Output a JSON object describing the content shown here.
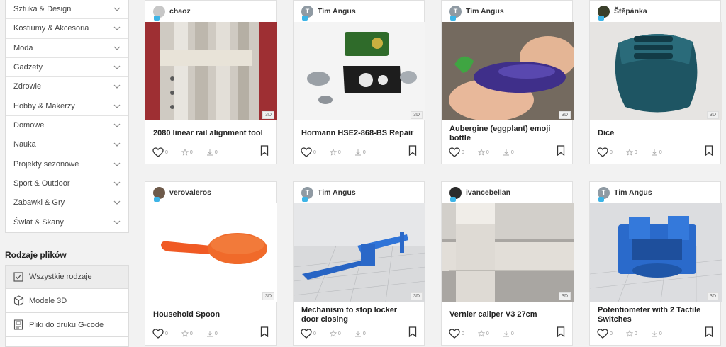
{
  "sidebar": {
    "categories": [
      "Sztuka & Design",
      "Kostiumy & Akcesoria",
      "Moda",
      "Gadżety",
      "Zdrowie",
      "Hobby & Makerzy",
      "Domowe",
      "Nauka",
      "Projekty sezonowe",
      "Sport & Outdoor",
      "Zabawki & Gry",
      "Świat & Skany"
    ],
    "file_types_title": "Rodzaje plików",
    "file_types": [
      "Wszystkie rodzaje",
      "Modele 3D",
      "Pliki do druku G-code"
    ]
  },
  "cards": [
    {
      "author": "chaoz",
      "avatar_initial": "",
      "title": "2080 linear rail alignment tool",
      "likes": "0",
      "stars": "0",
      "downloads": "0",
      "badge": "3D"
    },
    {
      "author": "Tim Angus",
      "avatar_initial": "T",
      "title": "Hormann HSE2-868-BS Repair",
      "likes": "0",
      "stars": "0",
      "downloads": "0",
      "badge": "3D"
    },
    {
      "author": "Tim Angus",
      "avatar_initial": "T",
      "title": "Aubergine (eggplant) emoji bottle",
      "likes": "0",
      "stars": "0",
      "downloads": "0",
      "badge": "3D"
    },
    {
      "author": "Štěpánka",
      "avatar_initial": "",
      "title": "Dice",
      "likes": "0",
      "stars": "0",
      "downloads": "0",
      "badge": "3D"
    },
    {
      "author": "verovaleros",
      "avatar_initial": "",
      "title": "Household Spoon",
      "likes": "0",
      "stars": "0",
      "downloads": "0",
      "badge": "3D"
    },
    {
      "author": "Tim Angus",
      "avatar_initial": "T",
      "title": "Mechanism to stop locker door closing",
      "likes": "0",
      "stars": "0",
      "downloads": "0",
      "badge": "3D"
    },
    {
      "author": "ivancebellan",
      "avatar_initial": "",
      "title": "Vernier caliper V3 27cm",
      "likes": "0",
      "stars": "0",
      "downloads": "0",
      "badge": "3D"
    },
    {
      "author": "Tim Angus",
      "avatar_initial": "T",
      "title": "Potentiometer with 2 Tactile Switches",
      "likes": "0",
      "stars": "0",
      "downloads": "0",
      "badge": "3D"
    }
  ]
}
